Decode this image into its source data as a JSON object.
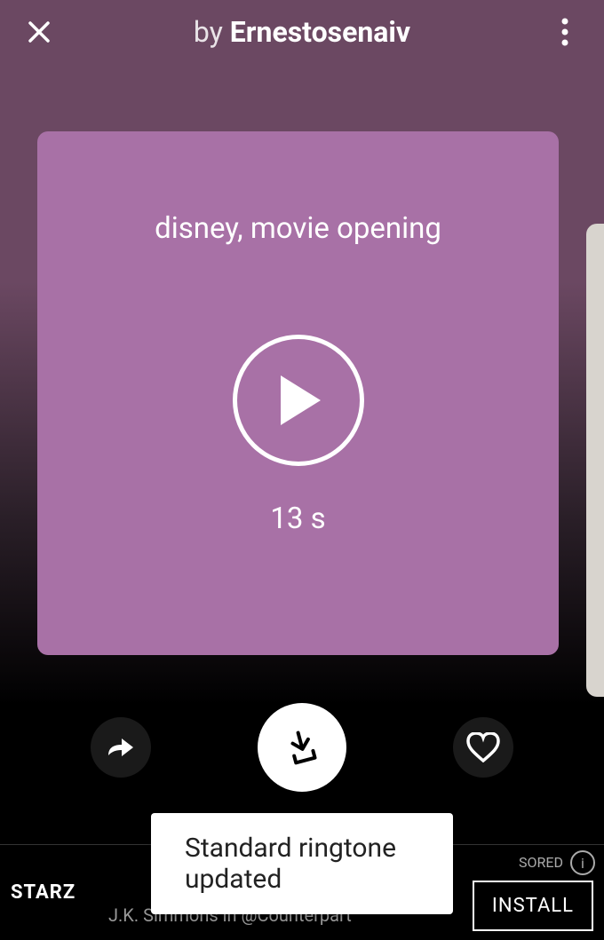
{
  "header": {
    "by_label": "by",
    "author_name": "Ernestosenaiv"
  },
  "card": {
    "title": "disney, movie opening",
    "duration": "13 s"
  },
  "toast": {
    "message": "Standard ringtone updated"
  },
  "ad": {
    "logo": "STARZ",
    "text": "J.K. Simmons in @Counterpart",
    "sponsored_label": "SORED",
    "install_label": "INSTALL"
  }
}
